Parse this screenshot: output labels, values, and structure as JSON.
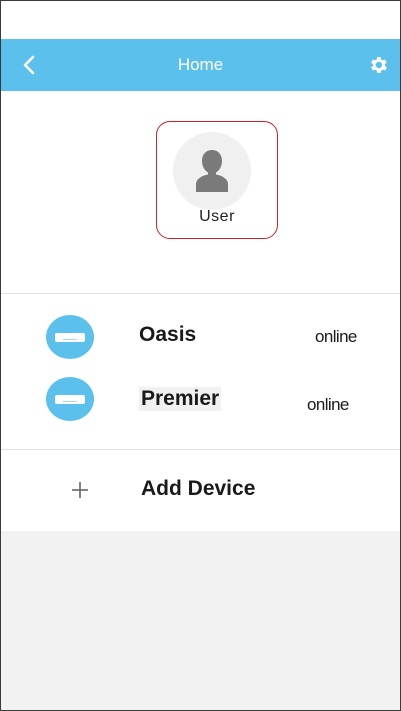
{
  "navbar": {
    "title": "Home",
    "back_icon": "chevron-left-icon",
    "settings_icon": "gear-icon",
    "color": "#5bc1ec"
  },
  "user": {
    "label": "User",
    "avatar_icon": "person-icon"
  },
  "devices": [
    {
      "name": "Oasis",
      "status": "online",
      "icon": "air-conditioner-icon"
    },
    {
      "name": "Premier",
      "status": "online",
      "icon": "air-conditioner-icon"
    }
  ],
  "add_device": {
    "label": "Add Device",
    "icon": "plus-icon"
  },
  "colors": {
    "accent": "#5bc1ec",
    "highlight_border": "#c9222a",
    "footer_bg": "#f2f2f2"
  }
}
